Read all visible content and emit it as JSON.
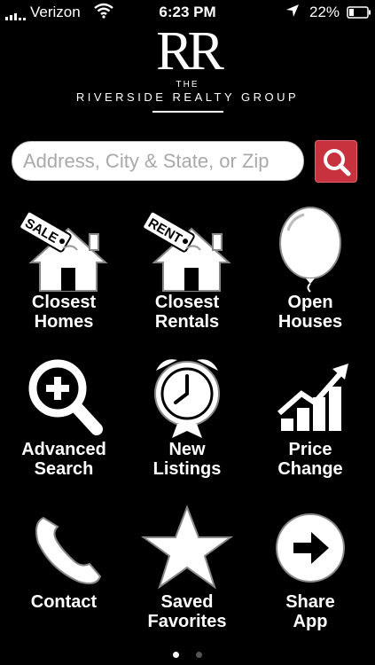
{
  "status": {
    "carrier": "Verizon",
    "time": "6:23 PM",
    "battery": "22%"
  },
  "brand": {
    "monogram": "RR",
    "the": "THE",
    "name": "RIVERSIDE REALTY GROUP"
  },
  "search": {
    "placeholder": "Address, City & State, or Zip",
    "button_color": "#c8323f"
  },
  "tiles": [
    {
      "label": "Closest\nHomes",
      "icon": "sale-house-icon",
      "tag": "SALE"
    },
    {
      "label": "Closest\nRentals",
      "icon": "rent-house-icon",
      "tag": "RENT"
    },
    {
      "label": "Open\nHouses",
      "icon": "balloon-icon"
    },
    {
      "label": "Advanced\nSearch",
      "icon": "magnify-plus-icon"
    },
    {
      "label": "New\nListings",
      "icon": "alarm-clock-icon"
    },
    {
      "label": "Price\nChange",
      "icon": "bar-chart-arrow-icon"
    },
    {
      "label": "Contact",
      "icon": "phone-icon"
    },
    {
      "label": "Saved\nFavorites",
      "icon": "star-icon"
    },
    {
      "label": "Share\nApp",
      "icon": "arrow-circle-icon"
    }
  ],
  "pager": {
    "pages": 2,
    "current": 1
  }
}
